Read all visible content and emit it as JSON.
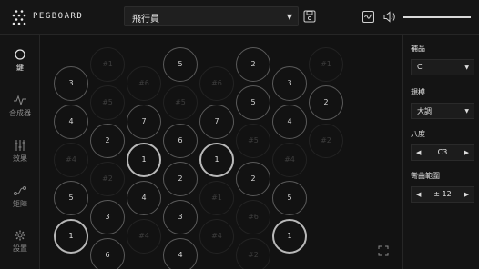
{
  "app": {
    "logo_text": "PEGBOARD"
  },
  "header": {
    "preset_value": "飛行員",
    "volume": 1.0
  },
  "nav": {
    "items": [
      {
        "id": "keys",
        "label": "鍵",
        "icon": "circle-icon"
      },
      {
        "id": "synth",
        "label": "合成器",
        "icon": "waveform-icon"
      },
      {
        "id": "effects",
        "label": "效果",
        "icon": "sliders-icon"
      },
      {
        "id": "matrix",
        "label": "矩陣",
        "icon": "routing-icon"
      },
      {
        "id": "settings",
        "label": "設置",
        "icon": "gear-icon"
      }
    ]
  },
  "grid": {
    "pegs": [
      {
        "label": "3",
        "state": "on"
      },
      {
        "label": "4",
        "state": "on"
      },
      {
        "label": "#4",
        "state": "off"
      },
      {
        "label": "5",
        "state": "on"
      },
      {
        "label": "1",
        "state": "active"
      },
      {
        "label": "#1",
        "state": "off"
      },
      {
        "label": "#5",
        "state": "off"
      },
      {
        "label": "2",
        "state": "on"
      },
      {
        "label": "#2",
        "state": "off"
      },
      {
        "label": "3",
        "state": "on"
      },
      {
        "label": "6",
        "state": "on"
      },
      {
        "label": "#6",
        "state": "off"
      },
      {
        "label": "7",
        "state": "on"
      },
      {
        "label": "1",
        "state": "active"
      },
      {
        "label": "4",
        "state": "on"
      },
      {
        "label": "#4",
        "state": "off"
      },
      {
        "label": "5",
        "state": "on"
      },
      {
        "label": "#5",
        "state": "off"
      },
      {
        "label": "6",
        "state": "on"
      },
      {
        "label": "2",
        "state": "on"
      },
      {
        "label": "3",
        "state": "on"
      },
      {
        "label": "4",
        "state": "on"
      },
      {
        "label": "#6",
        "state": "off"
      },
      {
        "label": "7",
        "state": "on"
      },
      {
        "label": "1",
        "state": "active"
      },
      {
        "label": "#1",
        "state": "off"
      },
      {
        "label": "#4",
        "state": "off"
      },
      {
        "label": "2",
        "state": "on"
      },
      {
        "label": "5",
        "state": "on"
      },
      {
        "label": "#5",
        "state": "off"
      },
      {
        "label": "2",
        "state": "on"
      },
      {
        "label": "#6",
        "state": "off"
      },
      {
        "label": "#2",
        "state": "off"
      },
      {
        "label": "3",
        "state": "on"
      },
      {
        "label": "4",
        "state": "on"
      },
      {
        "label": "#4",
        "state": "off"
      },
      {
        "label": "5",
        "state": "on"
      },
      {
        "label": "1",
        "state": "active"
      },
      {
        "label": "#1",
        "state": "off"
      },
      {
        "label": "2",
        "state": "on"
      },
      {
        "label": "#2",
        "state": "off"
      }
    ]
  },
  "panel": {
    "tonic_label": "補品",
    "tonic_value": "C",
    "scale_label": "規模",
    "scale_value": "大調",
    "octave_label": "八度",
    "octave_value": "C3",
    "bend_label": "彎曲範圍",
    "bend_value": "± 12",
    "dec_symbol": "◀",
    "inc_symbol": "▶",
    "dropdown_symbol": "▼"
  }
}
